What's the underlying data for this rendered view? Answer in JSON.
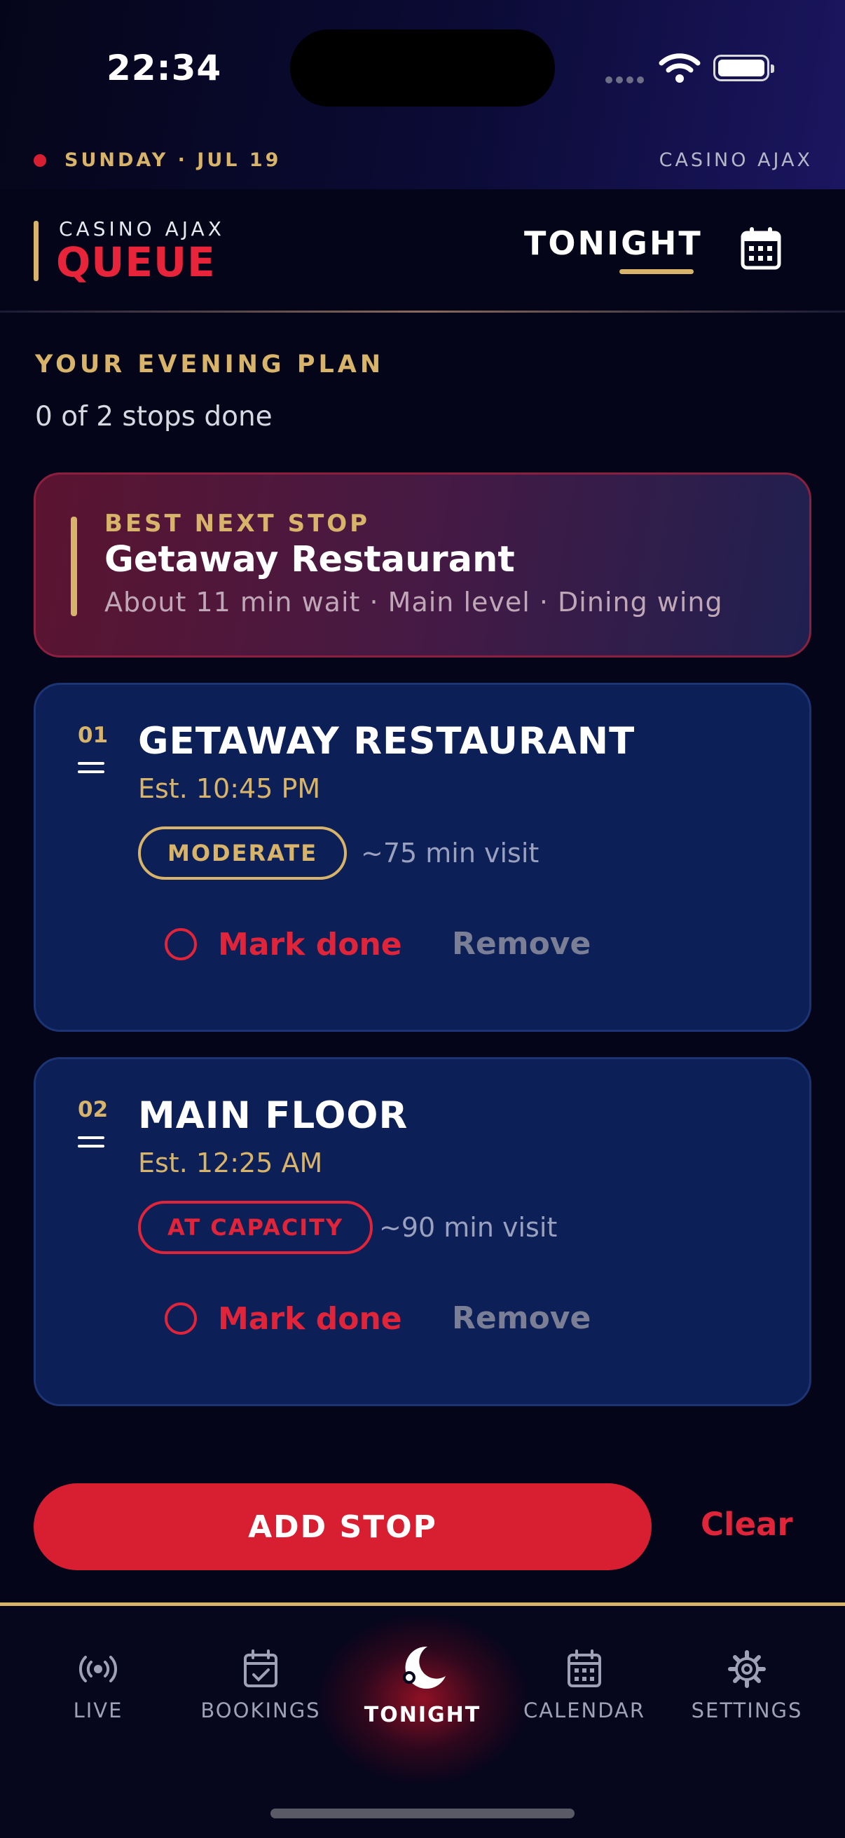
{
  "status_bar": {
    "time": "22:34"
  },
  "date_row": {
    "date": "SUNDAY · JUL 19",
    "venue": "CASINO AJAX"
  },
  "header": {
    "brand_sub": "CASINO AJAX",
    "brand_title": "QUEUE",
    "active_tab": "TONIGHT"
  },
  "plan": {
    "heading": "YOUR EVENING PLAN",
    "progress": "0 of 2 stops done"
  },
  "best_next": {
    "label": "BEST NEXT STOP",
    "title": "Getaway Restaurant",
    "detail": "About 11 min wait · Main level · Dining wing"
  },
  "stops": [
    {
      "number": "01",
      "name": "GETAWAY RESTAURANT",
      "est": "Est. 10:45 PM",
      "badge": "MODERATE",
      "visit": "~75 min visit",
      "mark_done": "Mark done",
      "remove": "Remove"
    },
    {
      "number": "02",
      "name": "MAIN FLOOR",
      "est": "Est. 12:25 AM",
      "badge": "AT CAPACITY",
      "visit": "~90 min visit",
      "mark_done": "Mark done",
      "remove": "Remove"
    }
  ],
  "actions": {
    "add_stop": "ADD STOP",
    "clear": "Clear"
  },
  "tabs": [
    {
      "label": "LIVE",
      "icon": "live-broadcast-icon"
    },
    {
      "label": "BOOKINGS",
      "icon": "calendar-check-icon"
    },
    {
      "label": "TONIGHT",
      "icon": "moon-icon"
    },
    {
      "label": "CALENDAR",
      "icon": "calendar-icon"
    },
    {
      "label": "SETTINGS",
      "icon": "gear-icon"
    }
  ],
  "colors": {
    "accent_red": "#d81f32",
    "accent_gold": "#d7b46a",
    "card_blue": "#0c1f56",
    "background": "#05051a"
  }
}
